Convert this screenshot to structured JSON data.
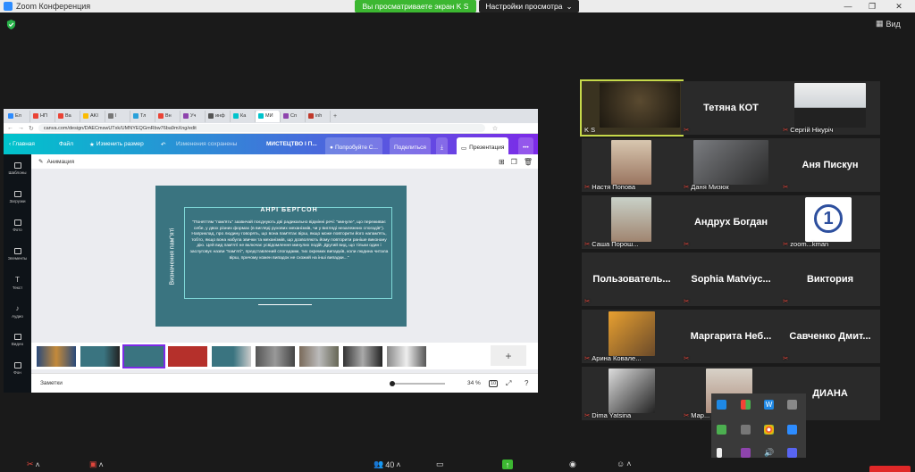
{
  "titlebar": {
    "app_title": "Zoom Конференция",
    "sharing_banner": "Вы просматриваете экран K S",
    "view_options": "Настройки просмотра"
  },
  "view_button": "Вид",
  "browser": {
    "tabs": [
      "Ел",
      "НП",
      "Ва",
      "AKI",
      "I",
      "Тл",
      "Вн",
      "Уч",
      "инф",
      "Ка",
      "МИ",
      "Сп",
      "inh"
    ],
    "url": "canva.com/design/DAECmswUTxk/UMNYEQGmRbw76ba9mXng/edit",
    "canva": {
      "home": "Главная",
      "file": "Файл",
      "resize": "Изменить размер",
      "saved": "Изменения сохранены",
      "doc_title": "МИСТЕЦТВО І П...",
      "try": "Попробуйте С...",
      "share": "Поделиться",
      "present": "Презентация",
      "sidebar": [
        "Шаблоны",
        "Загрузки",
        "Фото",
        "Элементы",
        "Текст",
        "Аудио",
        "Видео",
        "Фон"
      ],
      "animation": "Анимация",
      "slide": {
        "vertical_title": "Визначення пам\"яті",
        "quote_author": "АНРІ БЕРГСОН",
        "quote_text": "\"Поняттям \"пам'ять\" зазвичай поєднують дві радикально відмінні речі: \"минуле\", що переживає себе, у двох різних формах (в вигляді рухових механізмів, чи у вигляді незалежних спогадів\"). Наприклад, про людину говорять, що вона пам'ятає вірш, якщо може повторити його напам'ять, тобто, якщо вона набула звички та механізмів, що дозволяють йому повторити раніше виконану дію. Цей вид пам'яті не включає усвідомлення минулих подій. Другий вид, що тільки один і заслуговує назви \"пам'яті\", представлений спогадами, тих окремих випадків, коли людина читала вірш, причому кожен випадок не схожий на інші випадки...\""
      },
      "add_page": "+",
      "notes": "Заметки",
      "zoom": "34 %",
      "page_count": "10"
    }
  },
  "participants": [
    {
      "name": "K S",
      "label_only": true,
      "active": true
    },
    {
      "name": "Тетяна КОТ",
      "big": true
    },
    {
      "name": "Сергій Нікуріч",
      "label_only": true
    },
    {
      "name": "Настя Попова",
      "label_only": true
    },
    {
      "name": "Даня Мизюк",
      "label_only": true
    },
    {
      "name": "Аня Пискун",
      "big": true
    },
    {
      "name": "Саша Порош...",
      "label_only": true
    },
    {
      "name": "Андрух Богдан",
      "big": true
    },
    {
      "name": "zoom...kman",
      "label_only": true
    },
    {
      "name": "Пользователь...",
      "big": true
    },
    {
      "name": "Sophia Matviyc...",
      "big": true
    },
    {
      "name": "Виктория",
      "big": true
    },
    {
      "name": "Арина Ковале...",
      "label_only": true
    },
    {
      "name": "Маргарита Неб...",
      "big": true
    },
    {
      "name": "Савченко Дмит...",
      "big": true
    },
    {
      "name": "Dima Yatsina",
      "label_only": true
    },
    {
      "name": "Мар...",
      "label_only": true
    },
    {
      "name": "ДИАНА",
      "big": true
    }
  ],
  "toolbar": {
    "participants_count": "40"
  },
  "colors": {
    "share_green": "#3cb731",
    "active_border": "#c6d94a",
    "canva_purple": "#7d2ae8",
    "slide_teal": "#3a7480",
    "muted_red": "#e0463c"
  }
}
